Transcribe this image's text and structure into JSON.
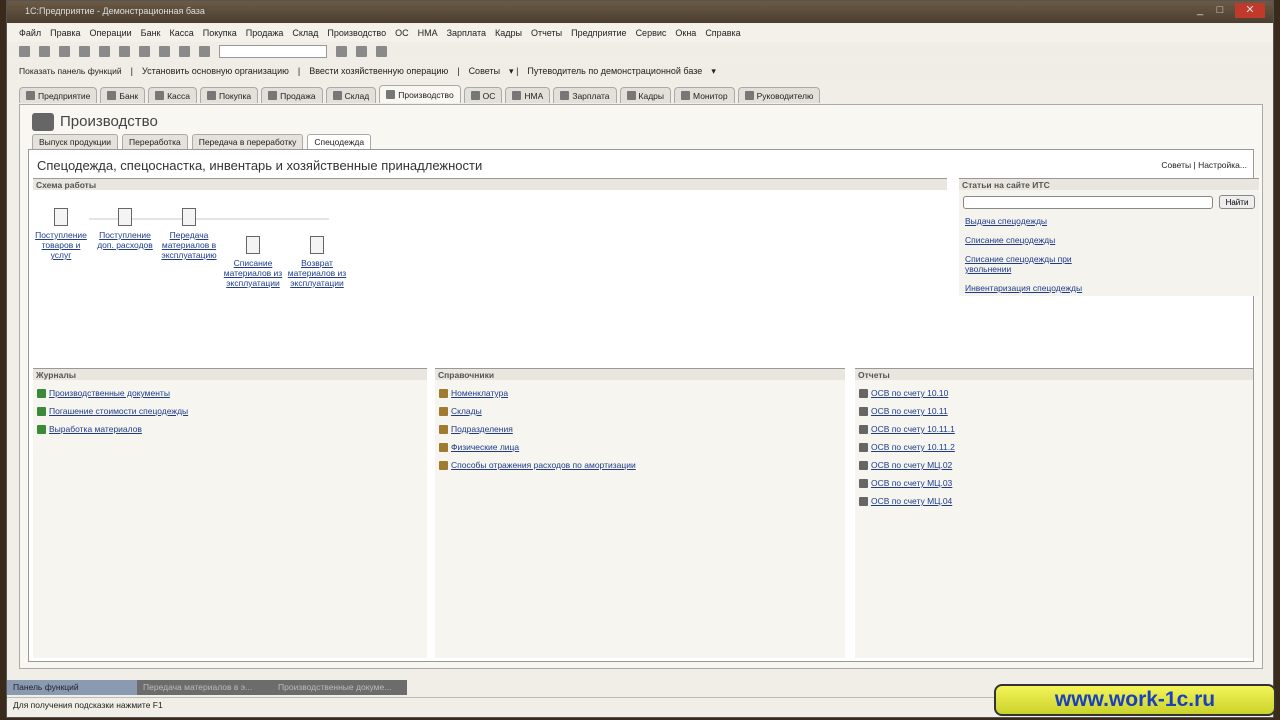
{
  "window": {
    "title": "1С:Предприятие - Демонстрационная база"
  },
  "menu": [
    "Файл",
    "Правка",
    "Операции",
    "Банк",
    "Касса",
    "Покупка",
    "Продажа",
    "Склад",
    "Производство",
    "ОС",
    "НМА",
    "Зарплата",
    "Кадры",
    "Отчеты",
    "Предприятие",
    "Сервис",
    "Окна",
    "Справка"
  ],
  "toolbar2": {
    "show_panel": "Показать панель функций",
    "set_org": "Установить основную организацию",
    "enter_op": "Ввести хозяйственную операцию",
    "tips": "Советы",
    "guide": "Путеводитель по демонстрационной базе"
  },
  "tabs": [
    "Предприятие",
    "Банк",
    "Касса",
    "Покупка",
    "Продажа",
    "Склад",
    "Производство",
    "ОС",
    "НМА",
    "Зарплата",
    "Кадры",
    "Монитор",
    "Руководителю"
  ],
  "page": {
    "title": "Производство",
    "subtabs": [
      "Выпуск продукции",
      "Переработка",
      "Передача в переработку",
      "Спецодежда"
    ],
    "panel_title": "Спецодежда, спецоснастка, инвентарь и хозяйственные принадлежности",
    "tips": "Советы",
    "settings": "Настройка..."
  },
  "scheme": {
    "title": "Схема работы",
    "nodes": [
      "Поступление товаров и услуг",
      "Поступление доп. расходов",
      "Передача материалов в эксплуатацию",
      "Списание материалов из эксплуатации",
      "Возврат материалов из эксплуатации"
    ]
  },
  "its": {
    "title": "Статьи на сайте ИТС",
    "search_value": "",
    "find": "Найти",
    "links": [
      "Выдача спецодежды",
      "Списание спецодежды",
      "Списание спецодежды при увольнении",
      "Инвентаризация спецодежды"
    ]
  },
  "journals": {
    "title": "Журналы",
    "items": [
      "Производственные документы",
      "Погашение стоимости спецодежды",
      "Выработка материалов"
    ]
  },
  "catalogs": {
    "title": "Справочники",
    "items": [
      "Номенклатура",
      "Склады",
      "Подразделения",
      "Физические лица",
      "Способы отражения расходов по амортизации"
    ]
  },
  "reports": {
    "title": "Отчеты",
    "items": [
      "ОСВ по счету 10.10",
      "ОСВ по счету 10.11",
      "ОСВ по счету 10.11.1",
      "ОСВ по счету 10.11.2",
      "ОСВ по счету МЦ.02",
      "ОСВ по счету МЦ.03",
      "ОСВ по счету МЦ.04"
    ]
  },
  "taskbar": [
    "Панель функций",
    "Передача материалов в э...",
    "Производственные докуме..."
  ],
  "status": "Для получения подсказки нажмите F1",
  "watermark": "www.work-1c.ru"
}
